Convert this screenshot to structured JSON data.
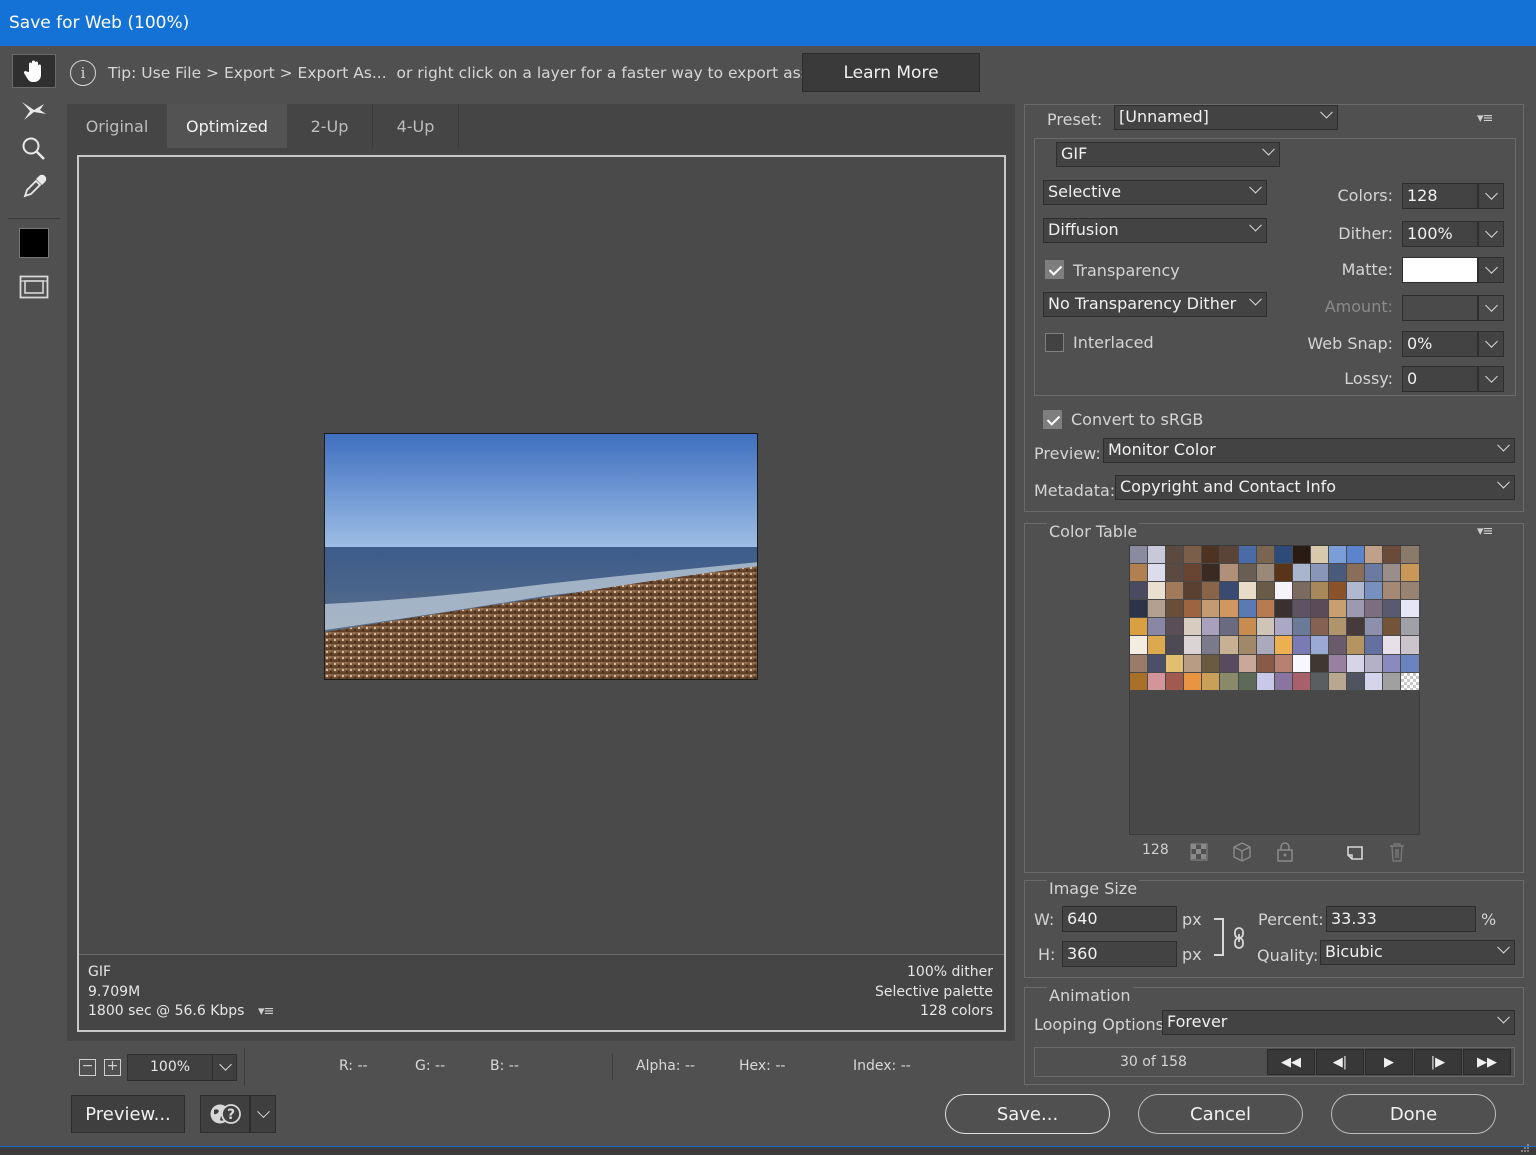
{
  "window": {
    "title": "Save for Web (100%)"
  },
  "tip": {
    "text": "Tip: Use File > Export > Export As...  or right click on a layer for a faster way to export assets",
    "learn_more": "Learn More"
  },
  "tools": [
    "hand-tool",
    "slice-select-tool",
    "zoom-tool",
    "eyedropper-tool",
    "eyedropper-color",
    "toggle-slices"
  ],
  "tabs": [
    {
      "label": "Original"
    },
    {
      "label": "Optimized",
      "active": true
    },
    {
      "label": "2-Up"
    },
    {
      "label": "4-Up"
    }
  ],
  "status": {
    "format": "GIF",
    "size": "9.709M",
    "time": "1800 sec @ 56.6 Kbps",
    "dither": "100% dither",
    "palette": "Selective palette",
    "colors": "128 colors"
  },
  "zoom": {
    "value": "100%"
  },
  "readout": {
    "r": "R: --",
    "g": "G: --",
    "b": "B: --",
    "alpha": "Alpha: --",
    "hex": "Hex: --",
    "index": "Index: --"
  },
  "buttons": {
    "preview": "Preview...",
    "save": "Save...",
    "cancel": "Cancel",
    "done": "Done"
  },
  "settings": {
    "preset_label": "Preset:",
    "preset": "[Unnamed]",
    "format": "GIF",
    "reduction": "Selective",
    "dither_algo": "Diffusion",
    "transparency_label": "Transparency",
    "transparency_checked": true,
    "transparency_dither": "No Transparency Dither",
    "interlaced_label": "Interlaced",
    "interlaced_checked": false,
    "colors_label": "Colors:",
    "colors": "128",
    "dither_label": "Dither:",
    "dither": "100%",
    "matte_label": "Matte:",
    "matte_color": "#ffffff",
    "amount_label": "Amount:",
    "amount": "",
    "websnap_label": "Web Snap:",
    "websnap": "0%",
    "lossy_label": "Lossy:",
    "lossy": "0",
    "convert_label": "Convert to sRGB",
    "convert_checked": true,
    "preview_label": "Preview:",
    "preview": "Monitor Color",
    "metadata_label": "Metadata:",
    "metadata": "Copyright and Contact Info"
  },
  "color_table": {
    "title": "Color Table",
    "count": "128",
    "swatches": [
      "#8a8aa0",
      "#c9c8d8",
      "#5a4a40",
      "#7a5e4a",
      "#4e3222",
      "#5a4438",
      "#4a6aa8",
      "#7a6650",
      "#2e4a78",
      "#2a1a14",
      "#d8c8ac",
      "#7a9ed8",
      "#5c84cc",
      "#c0a088",
      "#6a4a38",
      "#8a7a6a",
      "#b08050",
      "#dcdcec",
      "#5a4a42",
      "#6a4432",
      "#3a2a22",
      "#b09078",
      "#6a5e54",
      "#9a8878",
      "#5a3418",
      "#aab4cc",
      "#8a96b8",
      "#4a5a7a",
      "#8a6e5a",
      "#6a7aa0",
      "#9a8e8a",
      "#c89858",
      "#4a4a60",
      "#eae0d0",
      "#a07a5a",
      "#5a4030",
      "#8a6448",
      "#3a4a70",
      "#e8dcc8",
      "#6a5a48",
      "#f4f4f8",
      "#7a6a60",
      "#a8885a",
      "#8a5228",
      "#b0b8d0",
      "#7890c0",
      "#a48a74",
      "#988272",
      "#2e3448",
      "#b4a090",
      "#6a4e38",
      "#9c6440",
      "#c49a70",
      "#d09860",
      "#5a7ab4",
      "#b87a50",
      "#3a3030",
      "#5c5464",
      "#5a4a5a",
      "#c8a070",
      "#9c9ab0",
      "#7a6e80",
      "#585a70",
      "#e6e6f4",
      "#d8a040",
      "#8a86a6",
      "#5a4e58",
      "#d8ccc0",
      "#a8a0bc",
      "#6a6a80",
      "#c88c50",
      "#d0c4b8",
      "#aaa8c4",
      "#6a7a98",
      "#866050",
      "#b0946c",
      "#463a3a",
      "#8c90ac",
      "#745438",
      "#a0a0a8",
      "#f4ece0",
      "#dca850",
      "#4e4a54",
      "#dcd4d4",
      "#7a7a8a",
      "#c8b094",
      "#a08868",
      "#aaaabc",
      "#ecb050",
      "#7a7ab4",
      "#9aaad4",
      "#6a5a6a",
      "#b49460",
      "#6470a0",
      "#e8e0e8",
      "#ccc4cc",
      "#9a7a68",
      "#4a5068",
      "#e0c070",
      "#b89c84",
      "#6a5a40",
      "#5a4a60",
      "#c8a898",
      "#8a5a48",
      "#b88070",
      "#f8f8fc",
      "#403830",
      "#9880a0",
      "#d8d4e8",
      "#b4b0c8",
      "#8a8ac0",
      "#6a84c0",
      "#a87028",
      "#d4949c",
      "#a05a50",
      "#e89440",
      "#caa058",
      "#8a8a6a",
      "#5e6a58",
      "#c8c8e8",
      "#8a74a0",
      "#a8606a",
      "#5a5e60",
      "#b8a890",
      "#4e5460",
      "#d4d4ec",
      "#a0a0a0",
      "#e0e0e0"
    ]
  },
  "image_size": {
    "title": "Image Size",
    "w_label": "W:",
    "w": "640",
    "h_label": "H:",
    "h": "360",
    "unit": "px",
    "percent_label": "Percent:",
    "percent": "33.33",
    "percent_unit": "%",
    "quality_label": "Quality:",
    "quality": "Bicubic"
  },
  "animation": {
    "title": "Animation",
    "looping_label": "Looping Options:",
    "looping": "Forever",
    "frame": "30 of 158"
  }
}
